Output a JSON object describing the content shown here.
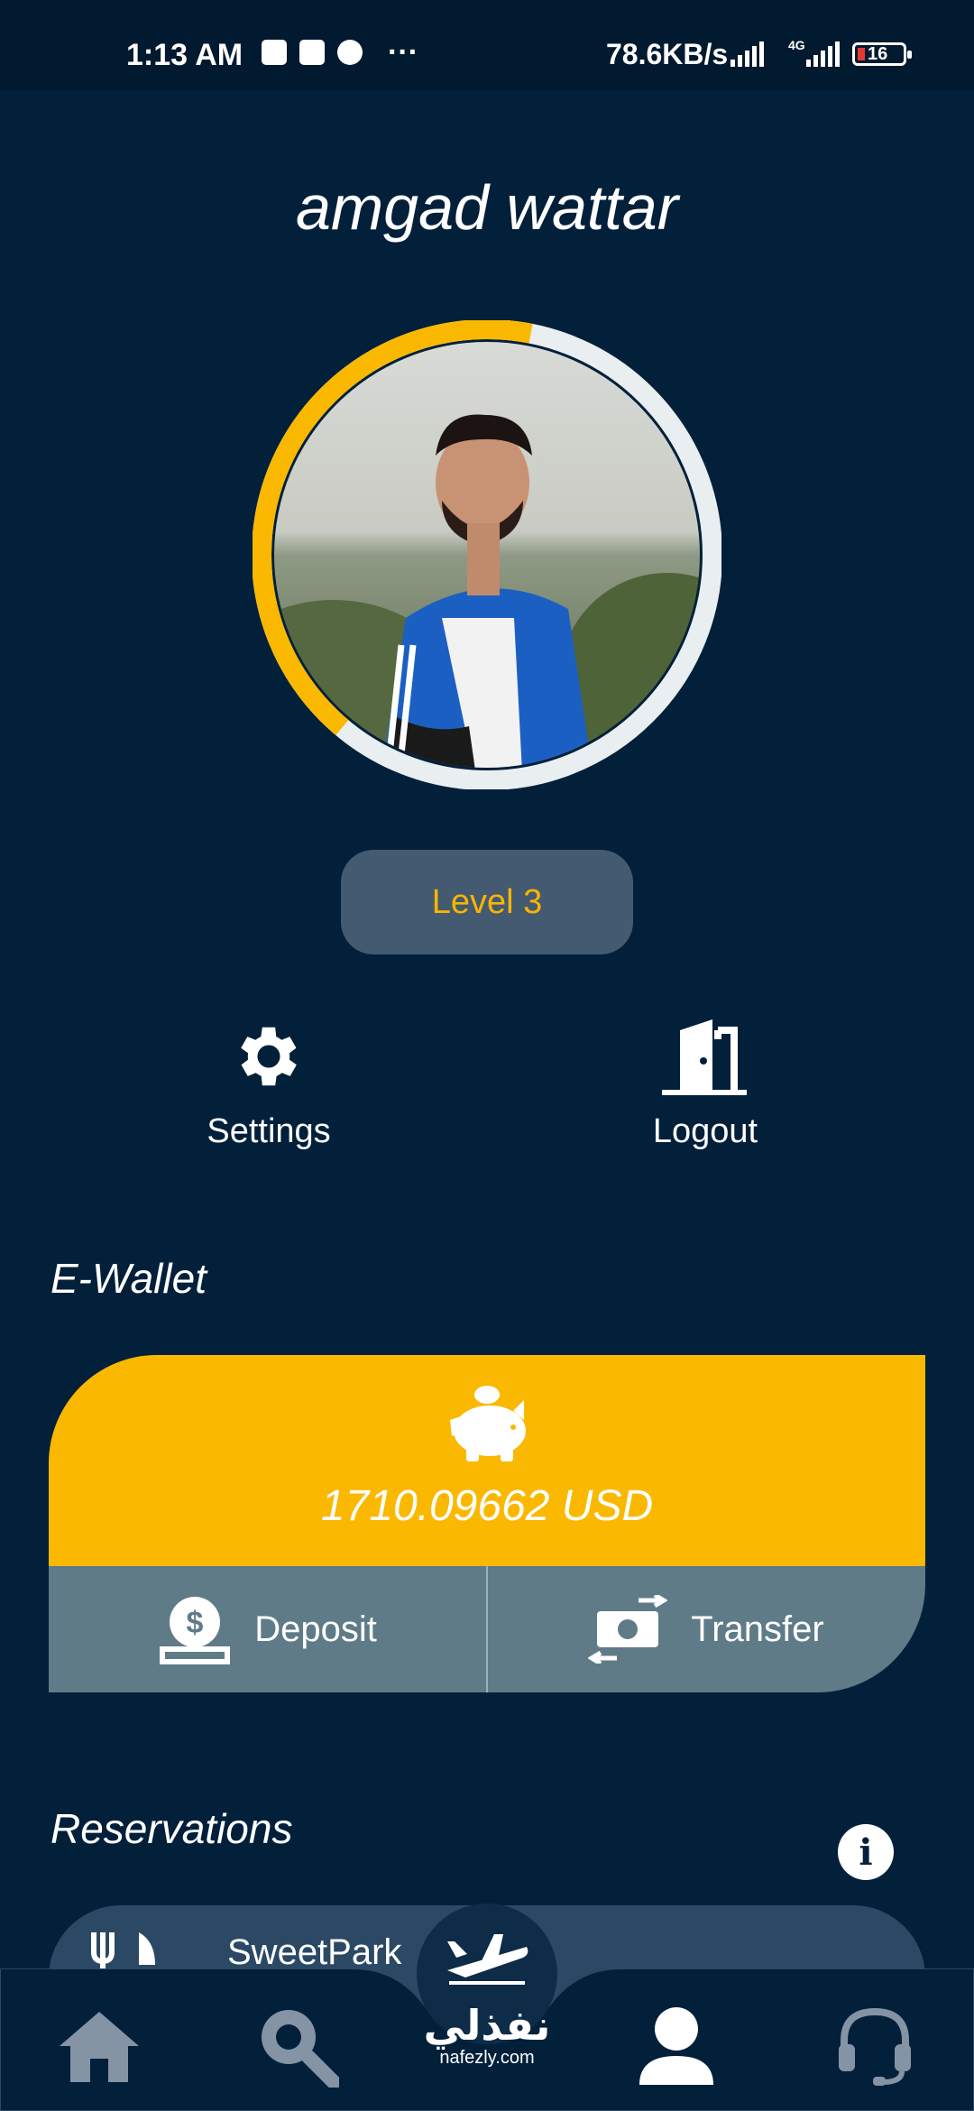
{
  "status_bar": {
    "time": "1:13 AM",
    "more": "···",
    "network_speed": "78.6KB/s",
    "network_type": "4G",
    "battery_level": "16"
  },
  "profile": {
    "name": "amgad wattar",
    "level_label": "Level 3",
    "level_progress_fraction": 0.42,
    "avatar_alt": "profile-photo"
  },
  "actions": {
    "settings_label": "Settings",
    "logout_label": "Logout"
  },
  "wallet": {
    "section_title": "E-Wallet",
    "balance": "1710.09662 USD",
    "deposit_label": "Deposit",
    "transfer_label": "Transfer"
  },
  "reservations": {
    "section_title": "Reservations",
    "items": [
      {
        "name": "SweetPark",
        "icon": "restaurant-icon"
      }
    ]
  },
  "bottom_nav": {
    "items": [
      "home-icon",
      "search-icon",
      "plane-icon",
      "user-icon",
      "support-headset-icon"
    ],
    "brand_ar": "نفذلي",
    "brand_url": "nafezly.com"
  },
  "colors": {
    "background": "#03203b",
    "accent": "#fbb800",
    "wallet_actions": "#5f7b87",
    "level_pill": "#435a70"
  }
}
